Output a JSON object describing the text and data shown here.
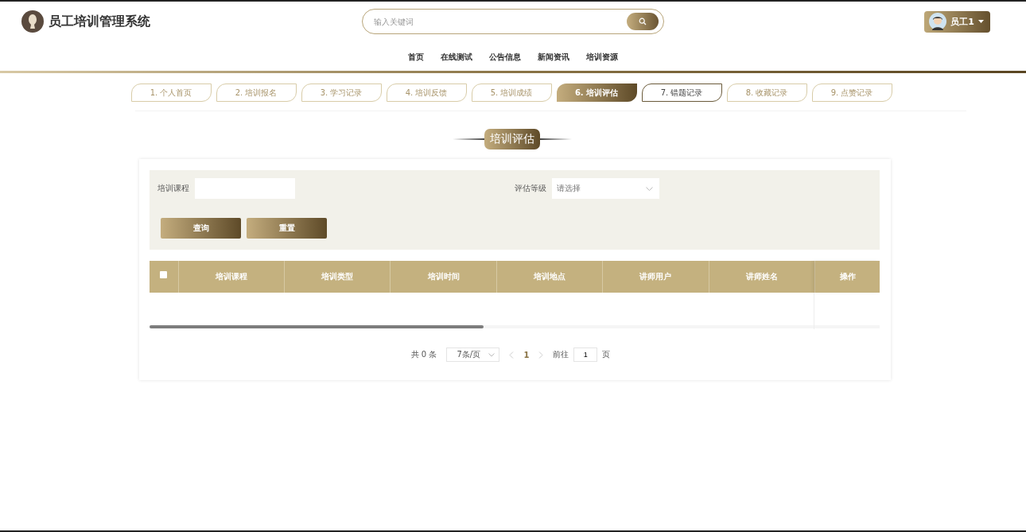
{
  "header": {
    "title": "员工培训管理系统",
    "search": {
      "placeholder": "输入关键词"
    },
    "user": {
      "name": "员工1"
    }
  },
  "nav": [
    "首页",
    "在线测试",
    "公告信息",
    "新闻资讯",
    "培训资源"
  ],
  "tabs": [
    {
      "label": "1. 个人首页",
      "selected": false,
      "hovered": false
    },
    {
      "label": "2. 培训报名",
      "selected": false,
      "hovered": false
    },
    {
      "label": "3. 学习记录",
      "selected": false,
      "hovered": false
    },
    {
      "label": "4. 培训反馈",
      "selected": false,
      "hovered": false
    },
    {
      "label": "5. 培训成绩",
      "selected": false,
      "hovered": false
    },
    {
      "label": "6. 培训评估",
      "selected": true,
      "hovered": false
    },
    {
      "label": "7. 错题记录",
      "selected": false,
      "hovered": true
    },
    {
      "label": "8. 收藏记录",
      "selected": false,
      "hovered": false
    },
    {
      "label": "9. 点赞记录",
      "selected": false,
      "hovered": false
    }
  ],
  "section_title": "培训评估",
  "filters": [
    {
      "label": "培训课程",
      "kind": "text"
    },
    {
      "label": "评估等级",
      "kind": "select",
      "placeholder": "请选择"
    }
  ],
  "buttons": [
    "查询",
    "重置"
  ],
  "table": {
    "select_all": {
      "checked": false
    },
    "columns": [
      "培训课程",
      "培训类型",
      "培训时间",
      "培训地点",
      "讲师用户",
      "讲师姓名"
    ],
    "action_column": "操作"
  },
  "pagination": {
    "total": "共 0 条",
    "page_size": "7条/页",
    "current": "1",
    "goto_label": "前往",
    "goto_value": "1",
    "page_unit": "页"
  }
}
